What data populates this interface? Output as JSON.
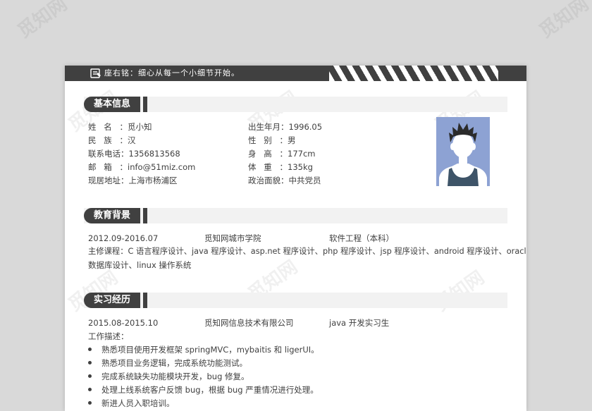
{
  "header": {
    "motto": "座右铭：细心从每一个小细节开始。",
    "icon": "resume-icon"
  },
  "sections": {
    "basic": "基本信息",
    "education": "教育背景",
    "internship": "实习经历"
  },
  "basic_info": {
    "name_label": "姓名：",
    "name": "觅小知",
    "ethnicity_label": "民族：",
    "ethnicity": "汉",
    "phone_label": "联系电话：",
    "phone": "1356813568",
    "email_label": "邮箱：",
    "email": "info@51miz.com",
    "address_label": "现居地址：",
    "address": "上海市杨浦区",
    "birth_label": "出生年月：",
    "birth": "1996.05",
    "gender_label": "性别：",
    "gender": "男",
    "height_label": "身高：",
    "height": "177cm",
    "weight_label": "体重：",
    "weight": "135kg",
    "politics_label": "政治面貌：",
    "politics": "中共党员"
  },
  "education": {
    "period": "2012.09-2016.07",
    "school": "觅知网城市学院",
    "major": "软件工程（本科）",
    "courses_line1": "主修课程：C 语言程序设计、java 程序设计、asp.net 程序设计、php 程序设计、jsp 程序设计、android 程序设计、oracle",
    "courses_line2": "数据库设计、linux 操作系统"
  },
  "internship": {
    "period": "2015.08-2015.10",
    "company": "觅知网信息技术有限公司",
    "role": "java 开发实习生",
    "desc_label": "工作描述：",
    "items": [
      "熟悉项目使用开发框架 springMVC，mybaitis 和 ligerUI。",
      "熟悉项目业务逻辑，完成系统功能测试。",
      "完成系统缺失功能模块开发，bug 修复。",
      "处理上线系统客户反馈 bug，根据 bug 严重情况进行处理。",
      "新进人员入职培训。"
    ]
  },
  "watermark": "觅知网",
  "colors": {
    "dark": "#404040",
    "section_bg": "#f2f2f2",
    "photo_bg": "#8da2d3"
  }
}
